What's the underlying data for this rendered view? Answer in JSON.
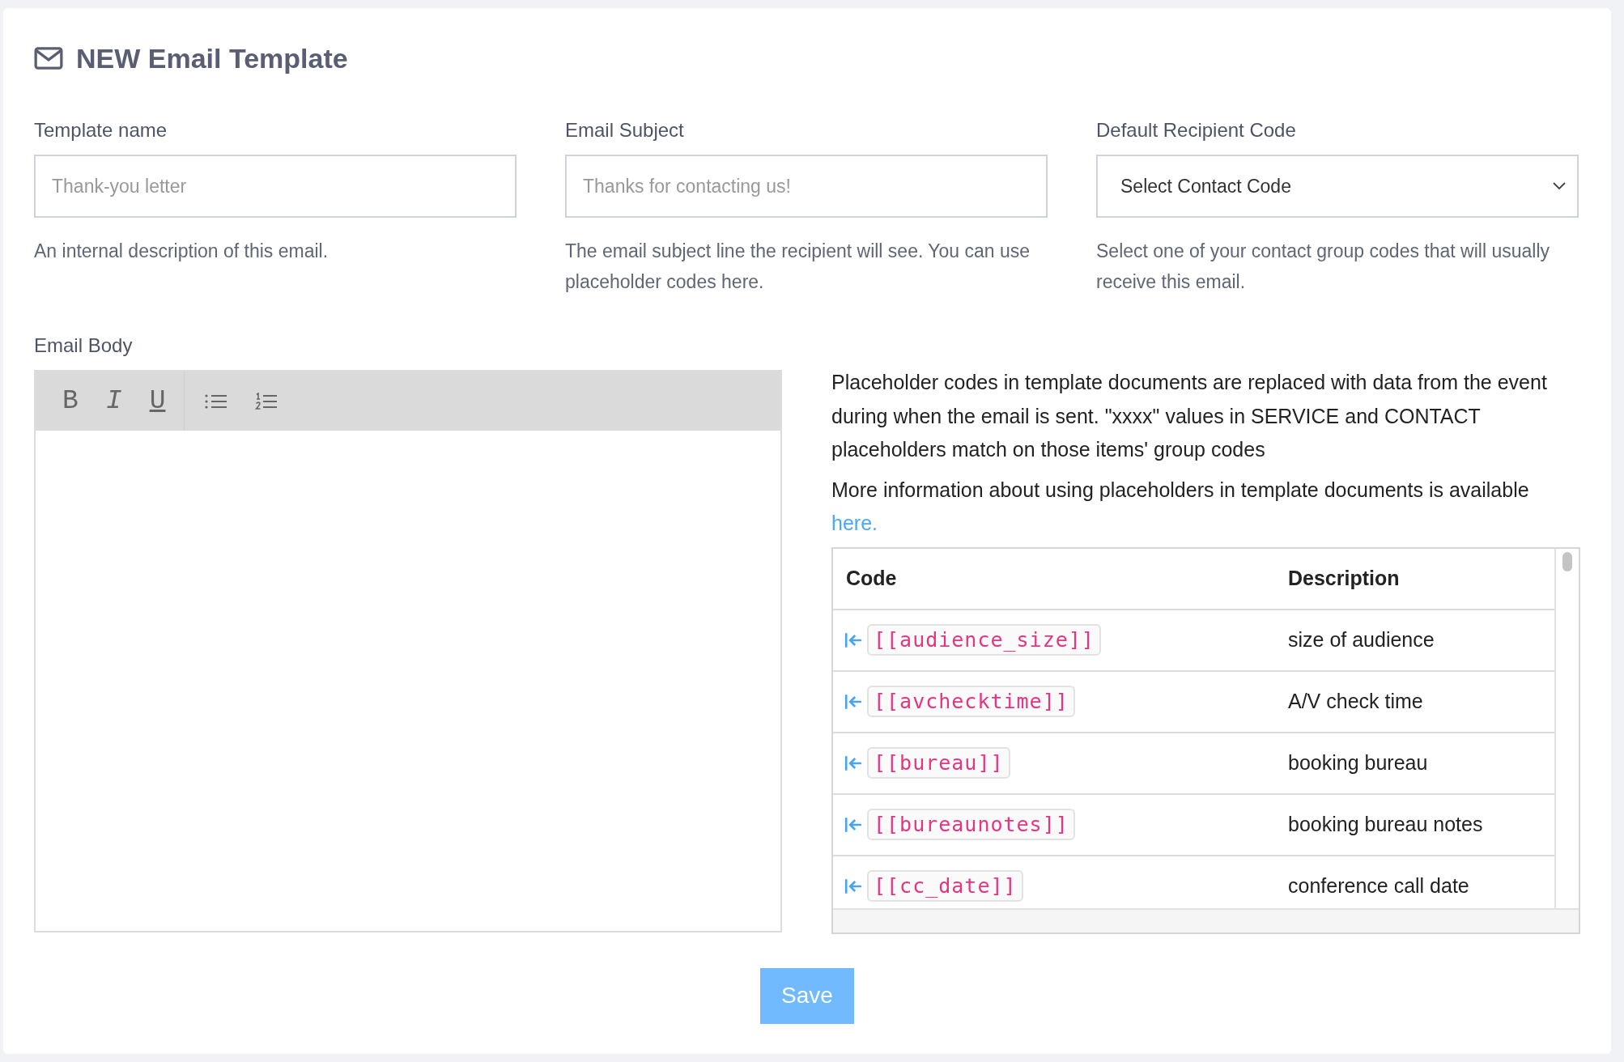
{
  "title": "NEW Email Template",
  "fields": [
    {
      "kind": "text",
      "label": "Template name",
      "placeholder": "Thank-you letter",
      "help": "An internal description of this email."
    },
    {
      "kind": "text",
      "label": "Email Subject",
      "placeholder": "Thanks for contacting us!",
      "help": "The email subject line the recipient will see. You can use placeholder codes here."
    },
    {
      "kind": "select",
      "label": "Default Recipient Code",
      "value": "Select Contact Code",
      "help": "Select one of your contact group codes that will usually receive this email."
    }
  ],
  "body": {
    "label": "Email Body",
    "toolbar": [
      {
        "kind": "bold",
        "label": "B"
      },
      {
        "kind": "italic",
        "label": "I"
      },
      {
        "kind": "underline",
        "label": "U"
      },
      {
        "kind": "bullet-list"
      },
      {
        "kind": "numbered-list"
      }
    ]
  },
  "info": {
    "paragraphs": [
      {
        "text": "Placeholder codes in template documents are replaced with data from the event during when the email is sent. \"xxxx\" values in SERVICE and CONTACT placeholders match on those items' group codes"
      },
      {
        "text": "More information about using placeholders in template documents is available",
        "link": "here."
      }
    ]
  },
  "table": {
    "columns": [
      "Code",
      "Description"
    ],
    "rows": [
      {
        "code": "[[audience_size]]",
        "description": "size of audience"
      },
      {
        "code": "[[avchecktime]]",
        "description": "A/V check time"
      },
      {
        "code": "[[bureau]]",
        "description": "booking bureau"
      },
      {
        "code": "[[bureaunotes]]",
        "description": "booking bureau notes"
      },
      {
        "code": "[[cc_date]]",
        "description": "conference call date"
      }
    ]
  },
  "save": "Save"
}
